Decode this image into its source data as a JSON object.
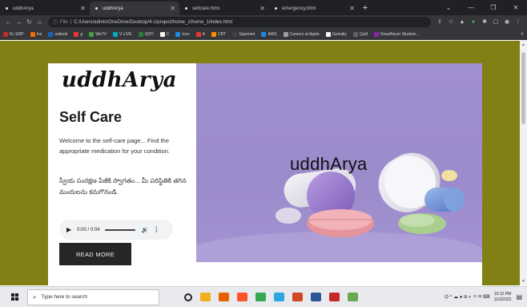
{
  "browser": {
    "tabs": [
      {
        "title": "uddhArya",
        "active": false
      },
      {
        "title": "uddhArya",
        "active": true
      },
      {
        "title": "selfcare.html",
        "active": false
      },
      {
        "title": "emergency.html",
        "active": false
      }
    ],
    "new_tab": "+",
    "address": {
      "prefix": "File",
      "url": "C:/Users/admin/OneDrive/Desktop/4-1/project/home_1/home_1/index.html"
    },
    "bookmarks": [
      {
        "label": "KL ERP",
        "color": "#c62828"
      },
      {
        "label": "Ins",
        "color": "#ef6c00"
      },
      {
        "label": "outlook",
        "color": "#1565c0"
      },
      {
        "label": "g",
        "color": "#e53935"
      },
      {
        "label": "WeTV",
        "color": "#43a047"
      },
      {
        "label": "V LIVE",
        "color": "#00acc1"
      },
      {
        "label": "iQIYI",
        "color": "#2e7d32"
      },
      {
        "label": "C",
        "color": "#f5f5f5"
      },
      {
        "label": "Icon",
        "color": "#1e88e5"
      },
      {
        "label": "A",
        "color": "#e53935"
      },
      {
        "label": "CRT",
        "color": "#fb8c00"
      },
      {
        "label": "Superset",
        "color": "#424242"
      },
      {
        "label": "AWS",
        "color": "#1e88e5"
      },
      {
        "label": "Careers at Apple",
        "color": "#9e9e9e"
      },
      {
        "label": "Genially",
        "color": "#f5f5f5"
      },
      {
        "label": "Quill",
        "color": "#616161"
      },
      {
        "label": "DeepRacer Student...",
        "color": "#8e24aa"
      }
    ],
    "bookmarks_more": "»"
  },
  "page": {
    "brand": "uddhArya",
    "heading": "Self Care",
    "description_en": "Welcome to the self-care page... Find the appropriate medication for your condition.",
    "description_te": "స్వీయ సంరక్షణ పేజీకి స్వాగతం... మీ పరిస్థితికి తగిన మందులను కనుగొనండి.",
    "audio": {
      "time": "0:00 / 0:04"
    },
    "read_more": "READ MORE",
    "hero_title": "uddhArya"
  },
  "taskbar": {
    "search_placeholder": "Type here to search",
    "apps": [
      {
        "name": "cortana",
        "color": "#222222"
      },
      {
        "name": "file-explorer",
        "color": "#f2b01e"
      },
      {
        "name": "firefox",
        "color": "#e66000"
      },
      {
        "name": "brave",
        "color": "#fb542b"
      },
      {
        "name": "chrome",
        "color": "#34a853"
      },
      {
        "name": "telegram",
        "color": "#2ca5e0"
      },
      {
        "name": "powerpoint",
        "color": "#d24726"
      },
      {
        "name": "word",
        "color": "#2b579a"
      },
      {
        "name": "star-app",
        "color": "#c62828"
      },
      {
        "name": "notepad",
        "color": "#6aa84f"
      }
    ],
    "time": "10:12 PM",
    "date": "11/3/2022"
  }
}
